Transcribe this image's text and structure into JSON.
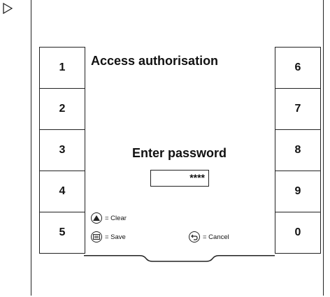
{
  "screen": {
    "title": "Access authorisation",
    "prompt": "Enter password",
    "password_value": "****"
  },
  "keypad": {
    "left": [
      "1",
      "2",
      "3",
      "4",
      "5"
    ],
    "right": [
      "6",
      "7",
      "8",
      "9",
      "0"
    ]
  },
  "legend": {
    "clear_label": "= Clear",
    "save_label": "= Save",
    "cancel_label": "= Cancel"
  },
  "icons": {
    "marker": "play-triangle-icon",
    "clear": "triangle-up-icon",
    "save": "menu-lines-icon",
    "cancel": "return-arrow-icon"
  }
}
